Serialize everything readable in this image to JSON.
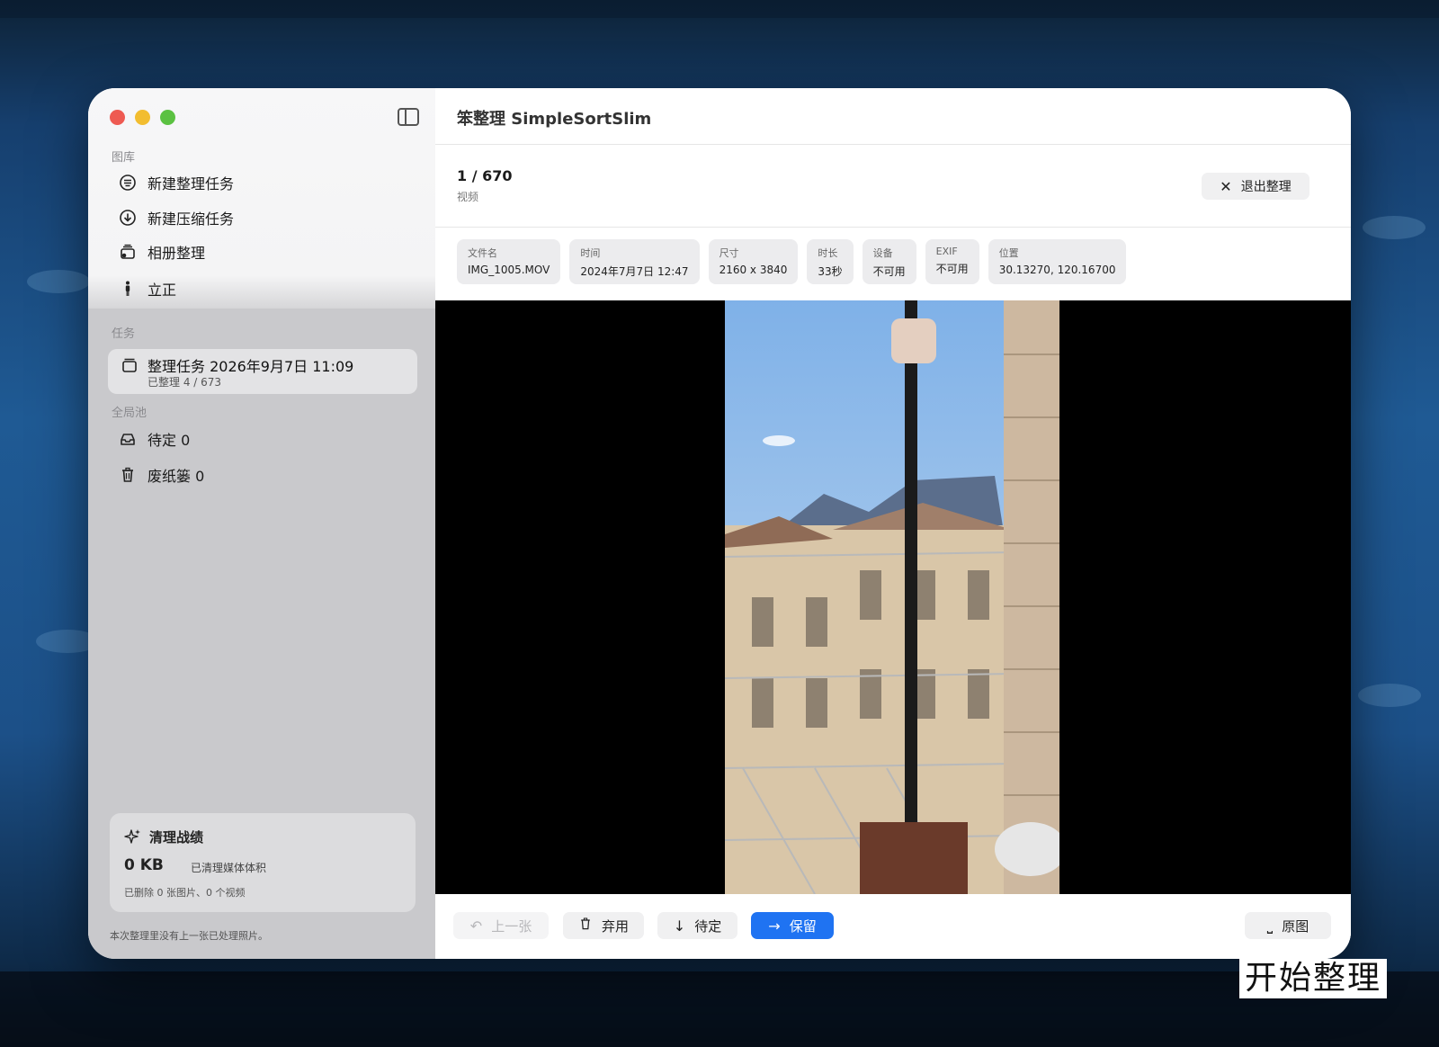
{
  "app": {
    "title": "笨整理 SimpleSortSlim"
  },
  "sidebar": {
    "library_section": "图库",
    "library_items": [
      {
        "label": "新建整理任务",
        "icon": "list-circle-icon"
      },
      {
        "label": "新建压缩任务",
        "icon": "download-circle-icon"
      },
      {
        "label": "相册整理",
        "icon": "albums-icon"
      },
      {
        "label": "立正",
        "icon": "person-standing-icon"
      }
    ],
    "tasks_section": "任务",
    "task": {
      "title": "整理任务 2026年9月7日 11:09",
      "subtitle": "已整理 4 / 673",
      "icon": "archive-box-icon"
    },
    "pool_section": "全局池",
    "pool_items": [
      {
        "label": "待定 0",
        "icon": "tray-icon"
      },
      {
        "label": "废纸篓 0",
        "icon": "trash-icon"
      }
    ],
    "stats": {
      "title": "清理战绩",
      "value": "0 KB",
      "value_label": "已清理媒体体积",
      "detail": "已删除 0 张图片、0 个视频"
    },
    "footer": "本次整理里没有上一张已处理照片。"
  },
  "main": {
    "counter": "1 / 670",
    "media_type": "视频",
    "exit_label": "退出整理",
    "meta": [
      {
        "label": "文件名",
        "value": "IMG_1005.MOV"
      },
      {
        "label": "时间",
        "value": "2024年7月7日 12:47"
      },
      {
        "label": "尺寸",
        "value": "2160 x 3840"
      },
      {
        "label": "时长",
        "value": "33秒"
      },
      {
        "label": "设备",
        "value": "不可用"
      },
      {
        "label": "EXIF",
        "value": "不可用"
      },
      {
        "label": "位置",
        "value": "30.13270, 120.16700"
      }
    ],
    "actions": {
      "prev": "上一张",
      "discard": "弃用",
      "pending": "待定",
      "keep": "保留",
      "original": "原图"
    }
  },
  "caption": "开始整理",
  "colors": {
    "accent": "#1f73f2",
    "sidebar": "#c9c9cc",
    "close": "#ee5a52",
    "minimize": "#f2bd30",
    "zoom": "#5bc142"
  }
}
